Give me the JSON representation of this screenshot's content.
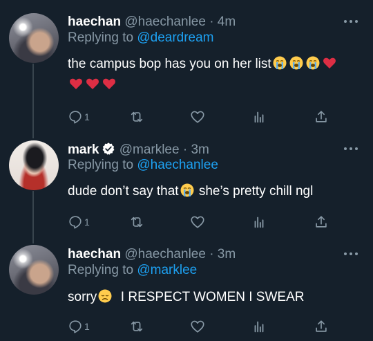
{
  "theme": {
    "background": "#15202b",
    "text": "#ffffff",
    "muted": "#8899a6",
    "link": "#1da1f2",
    "line": "#38444d"
  },
  "tweets": [
    {
      "display_name": "haechan",
      "handle_time": "@haechanlee · 4m",
      "reply_prefix": "Replying to",
      "reply_to": "@deardream",
      "text_line1": "the campus bop has you on her list",
      "emoji_line1": [
        "loudly-crying-face-emoji",
        "loudly-crying-face-emoji",
        "loudly-crying-face-emoji",
        "broken-heart-emoji"
      ],
      "emoji_line2": [
        "broken-heart-emoji",
        "broken-heart-emoji",
        "broken-heart-emoji"
      ],
      "reply_count": "1",
      "verified": false
    },
    {
      "display_name": "mark",
      "handle_time": "@marklee · 3m",
      "reply_prefix": "Replying to",
      "reply_to": "@haechanlee",
      "text_before_emoji": "dude don’t say that",
      "text_after_emoji": " she’s pretty chill ngl",
      "reply_count": "1",
      "verified": true
    },
    {
      "display_name": "haechan",
      "handle_time": "@haechanlee · 3m",
      "reply_prefix": "Replying to",
      "reply_to": "@marklee",
      "text_before_emoji": "sorry",
      "text_after_emoji": "  I RESPECT WOMEN I SWEAR",
      "reply_count": "1",
      "verified": false
    }
  ]
}
